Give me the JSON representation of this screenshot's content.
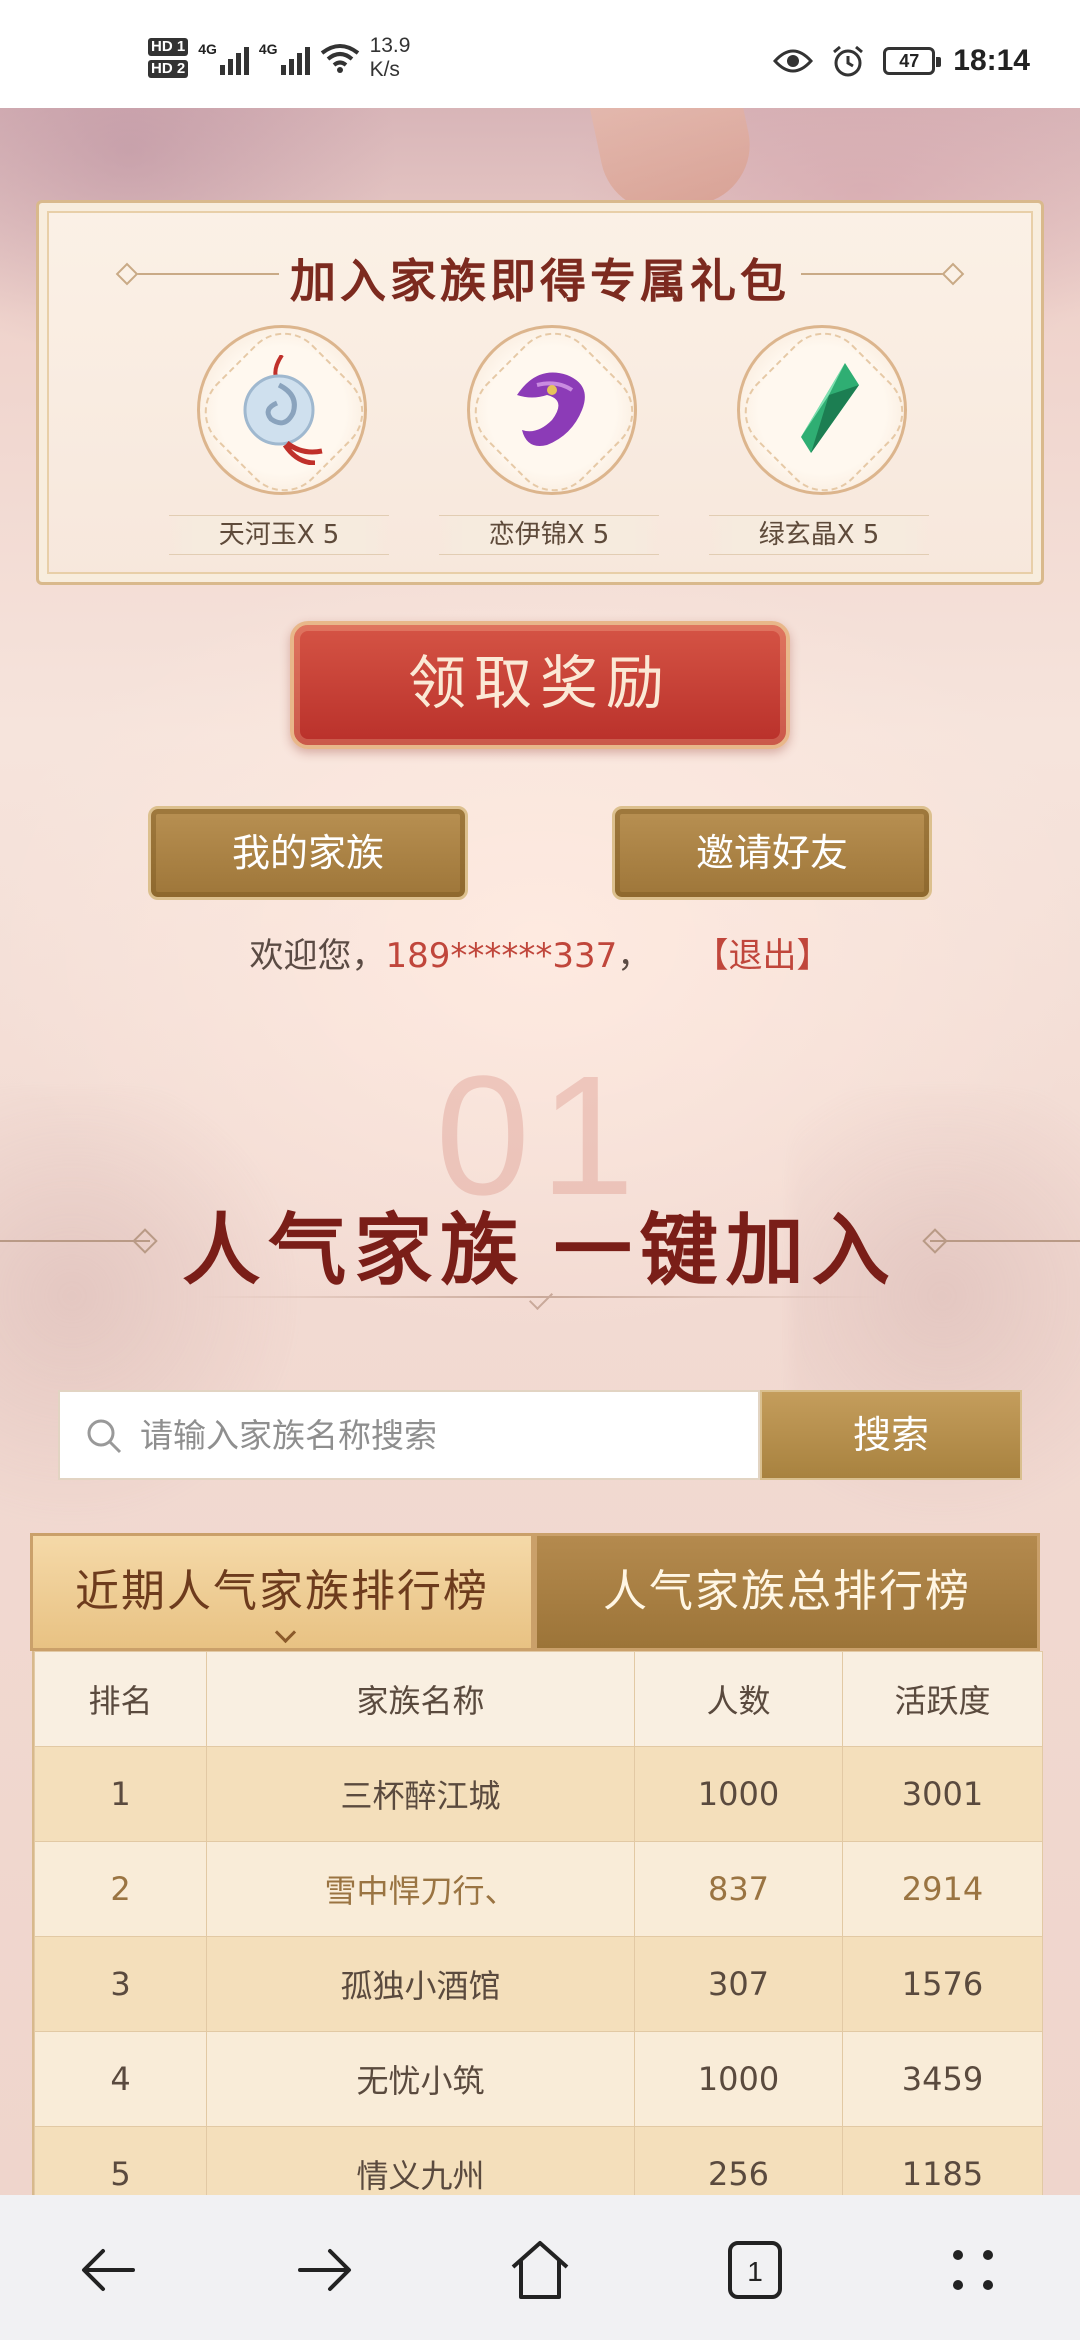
{
  "status_bar": {
    "sim1": "HD 1",
    "sim2": "HD 2",
    "network1": "4G",
    "network2": "4G",
    "speed_value": "13.9",
    "speed_unit": "K/s",
    "battery": "47",
    "time": "18:14"
  },
  "gift": {
    "title": "加入家族即得专属礼包",
    "items": [
      {
        "label": "天河玉X 5",
        "icon": "jade-pendant-icon"
      },
      {
        "label": "恋伊锦X 5",
        "icon": "purple-silk-icon"
      },
      {
        "label": "绿玄晶X 5",
        "icon": "green-crystal-icon"
      }
    ]
  },
  "actions": {
    "claim_label": "领取奖励",
    "my_family_label": "我的家族",
    "invite_label": "邀请好友"
  },
  "welcome": {
    "prefix": "欢迎您，",
    "phone": "189******337",
    "separator": "，",
    "logout": "【退出】"
  },
  "section": {
    "number": "01",
    "title": "人气家族 一键加入"
  },
  "search": {
    "placeholder": "请输入家族名称搜索",
    "button_label": "搜索"
  },
  "tabs": [
    {
      "label": "近期人气家族排行榜",
      "active": true
    },
    {
      "label": "人气家族总排行榜",
      "active": false
    }
  ],
  "table": {
    "headers": [
      "排名",
      "家族名称",
      "人数",
      "活跃度"
    ],
    "rows": [
      [
        "1",
        "三杯醉江城",
        "1000",
        "3001"
      ],
      [
        "2",
        "雪中悍刀行、",
        "837",
        "2914"
      ],
      [
        "3",
        "孤独小酒馆",
        "307",
        "1576"
      ],
      [
        "4",
        "无忧小筑",
        "1000",
        "3459"
      ],
      [
        "5",
        "情义九州",
        "256",
        "1185"
      ]
    ]
  },
  "nav": {
    "tab_count": "1"
  },
  "colors": {
    "accent_red": "#c0463b",
    "title_red": "#7a1e18",
    "gold": "#a8823f"
  }
}
